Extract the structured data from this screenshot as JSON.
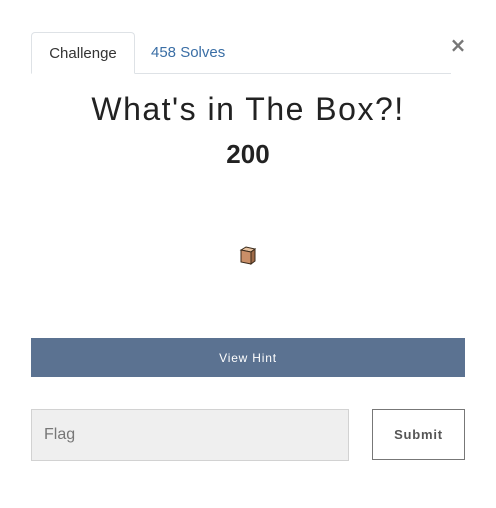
{
  "modal": {
    "close_label": "×"
  },
  "tabs": [
    {
      "label": "Challenge",
      "active": true
    },
    {
      "label": "458 Solves",
      "active": false
    }
  ],
  "challenge": {
    "title": "What's in The Box?!",
    "points": "200",
    "icon": "box-icon"
  },
  "hint": {
    "label": "View Hint"
  },
  "flag": {
    "placeholder": "Flag",
    "value": ""
  },
  "submit": {
    "label": "Submit"
  },
  "colors": {
    "hint_bg": "#5b7291",
    "link": "#3a6ea5",
    "input_bg": "#efefef"
  }
}
